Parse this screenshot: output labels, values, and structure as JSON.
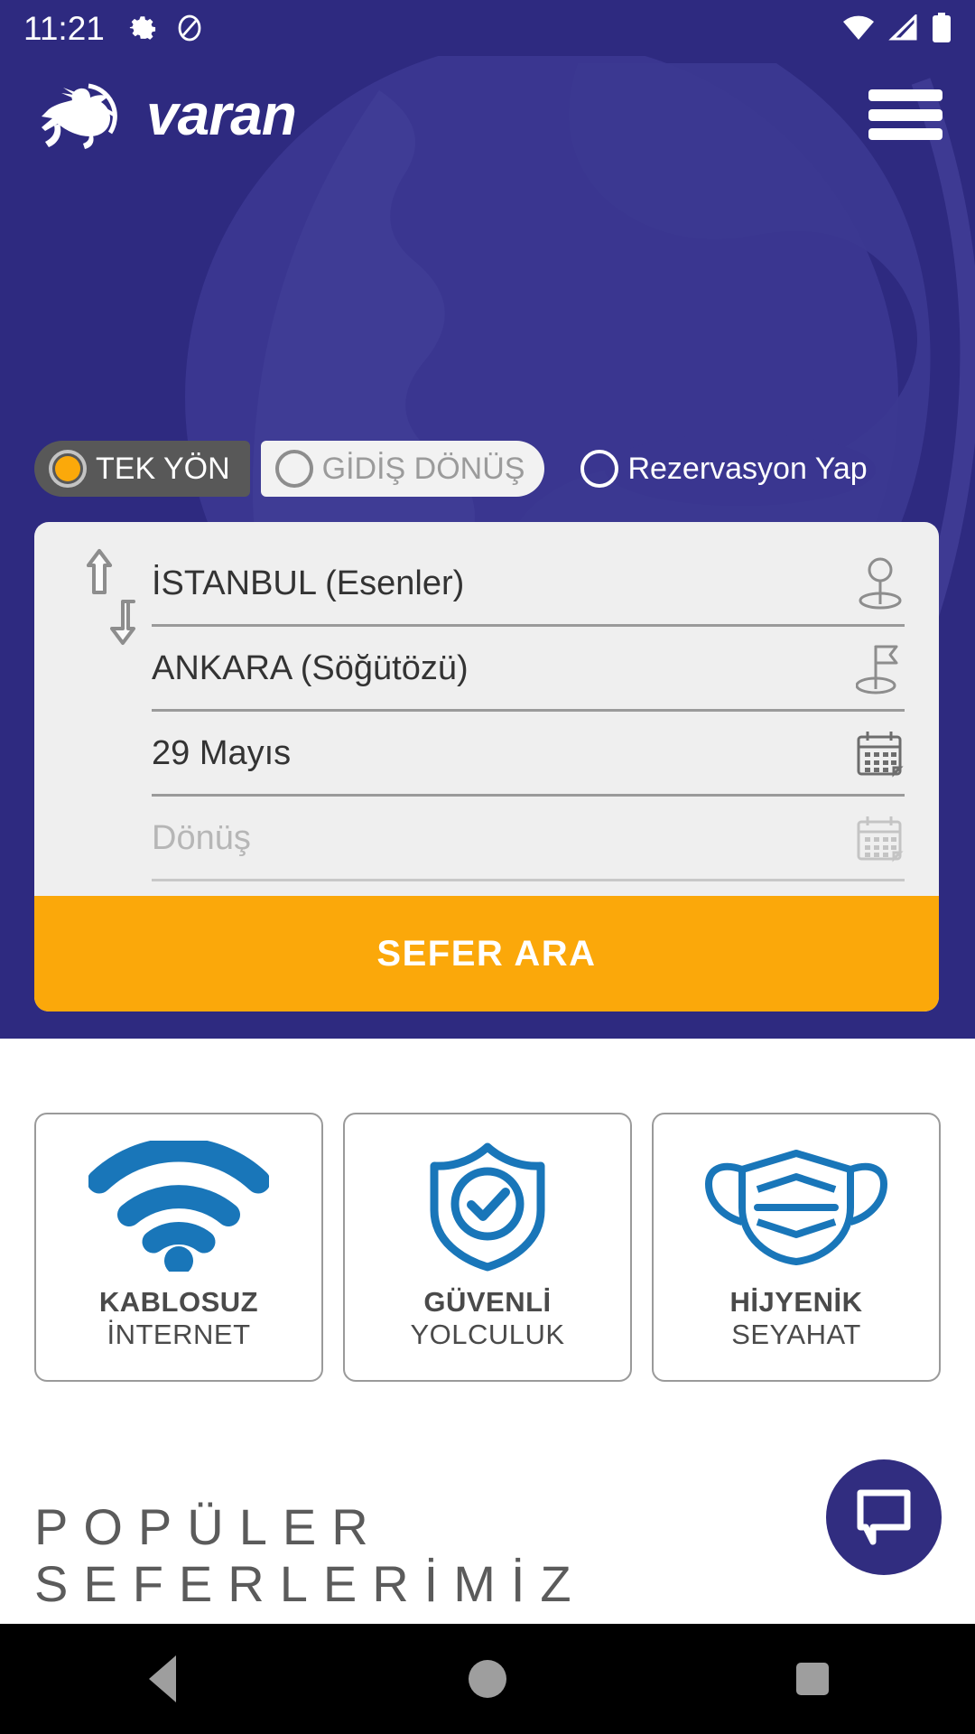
{
  "status_bar": {
    "time": "11:21",
    "left_icons": [
      "gear-icon",
      "do-not-disturb-icon"
    ],
    "right_icons": [
      "wifi-icon",
      "cellular-signal-icon",
      "battery-icon"
    ]
  },
  "header": {
    "brand": "varan",
    "logo_icon": "leaping-deer-logo",
    "menu_icon": "hamburger-menu-icon",
    "background_color": "#2E2A80"
  },
  "trip_type": {
    "options": [
      {
        "label": "TEK YÖN",
        "selected": true,
        "style": "dark-pill"
      },
      {
        "label": "GİDİŞ DÖNÜŞ",
        "selected": false,
        "style": "light-pill"
      },
      {
        "label": "Rezervasyon Yap",
        "selected": false,
        "style": "plain"
      }
    ],
    "selected_accent": "#FBA90A"
  },
  "search_form": {
    "swap_icon": "swap-vertical-arrows-icon",
    "origin": {
      "value": "İSTANBUL (Esenler)",
      "icon": "location-pin-icon",
      "enabled": true
    },
    "destination": {
      "value": "ANKARA (Söğütözü)",
      "icon": "flag-pin-icon",
      "enabled": true
    },
    "departure_date": {
      "value": "29 Mayıs",
      "icon": "calendar-icon",
      "enabled": true
    },
    "return_date": {
      "placeholder": "Dönüş",
      "icon": "calendar-icon",
      "enabled": false
    },
    "submit_label": "SEFER ARA",
    "submit_color": "#FBA80A"
  },
  "features": [
    {
      "icon": "wifi-icon",
      "title": "KABLOSUZ",
      "subtitle": "İNTERNET"
    },
    {
      "icon": "shield-check-icon",
      "title": "GÜVENLİ",
      "subtitle": "YOLCULUK"
    },
    {
      "icon": "face-mask-icon",
      "title": "HİJYENİK",
      "subtitle": "SEYAHAT"
    }
  ],
  "feature_icon_color": "#1976B9",
  "popular_section": {
    "line1": "POPÜLER",
    "line2": "SEFERLERİMİZ"
  },
  "chat_fab": {
    "icon": "chat-bubble-icon",
    "color": "#312D80"
  },
  "nav_bar": {
    "back": "back-triangle-icon",
    "home": "home-circle-icon",
    "recents": "recents-square-icon"
  }
}
